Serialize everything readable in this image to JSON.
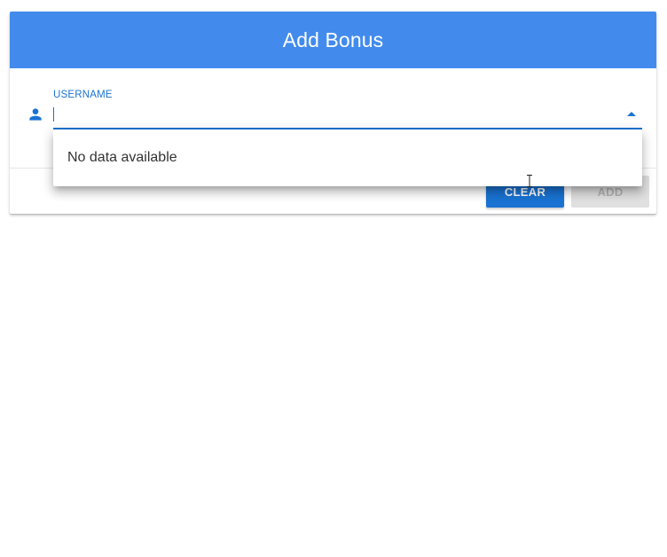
{
  "dialog": {
    "title": "Add Bonus"
  },
  "username_field": {
    "label": "USERNAME",
    "value": "",
    "icon": "person-icon"
  },
  "dropdown": {
    "empty_message": "No data available",
    "arrow_icon": "arrow-drop-up-icon"
  },
  "actions": {
    "clear_label": "CLEAR",
    "add_label": "ADD"
  },
  "colors": {
    "header": "#428bed",
    "accent": "#1a73d3",
    "disabled_button": "#e0e0e0"
  }
}
